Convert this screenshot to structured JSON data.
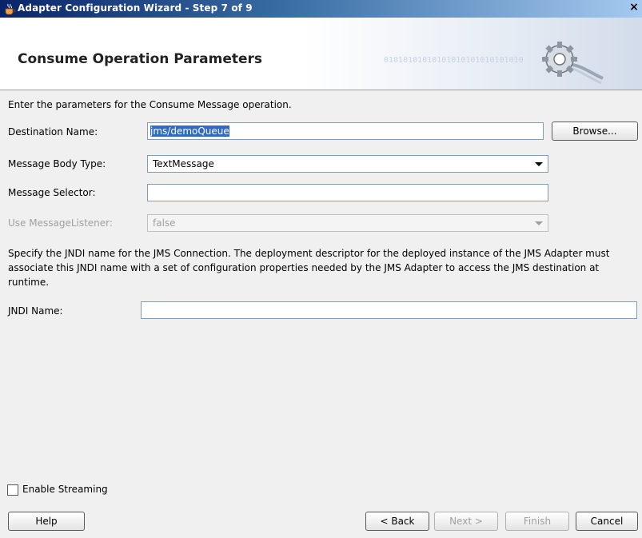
{
  "window": {
    "title": "Adapter Configuration Wizard - Step 7 of 9",
    "close_glyph": "×"
  },
  "banner": {
    "heading": "Consume Operation Parameters",
    "binary_text": "01010101010101010101010101010"
  },
  "intro": "Enter the parameters for the Consume Message operation.",
  "form": {
    "destination_name": {
      "label": "Destination Name:",
      "value": "jms/demoQueue",
      "browse_label": "Browse..."
    },
    "message_body_type": {
      "label": "Message Body Type:",
      "value": "TextMessage"
    },
    "message_selector": {
      "label": "Message Selector:",
      "value": ""
    },
    "use_message_listener": {
      "label": "Use MessageListener:",
      "value": "false"
    }
  },
  "jndi": {
    "description": "Specify the JNDI name for the JMS Connection.  The deployment descriptor for the deployed instance of the JMS Adapter must associate this JNDI name with a set of configuration properties needed by the JMS Adapter to access the JMS destination at runtime.",
    "label": "JNDI Name:",
    "value": ""
  },
  "streaming": {
    "label": "Enable Streaming",
    "checked": false
  },
  "buttons": {
    "help": "Help",
    "back": "< Back",
    "next": "Next >",
    "finish": "Finish",
    "cancel": "Cancel"
  }
}
